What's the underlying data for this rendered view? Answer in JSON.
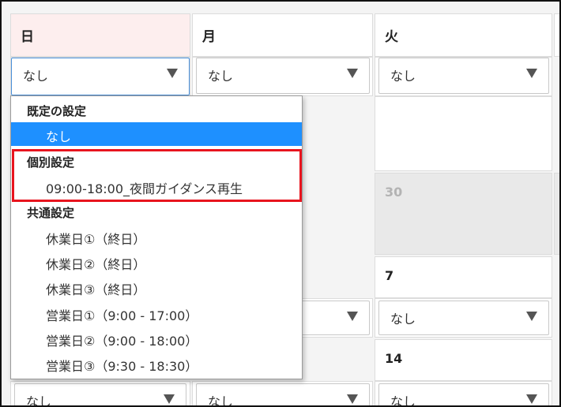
{
  "calendar": {
    "weekdays": {
      "sun": "日",
      "mon": "月",
      "tue": "火"
    },
    "dates": {
      "tue_row2": "30",
      "tue_row3": "7",
      "tue_row4": "14"
    },
    "select_default_value": "なし"
  },
  "dropdown": {
    "groups": {
      "default": {
        "label": "既定の設定",
        "options": [
          "なし"
        ],
        "selected_index": 0
      },
      "individual": {
        "label": "個別設定",
        "options": [
          "09:00-18:00_夜間ガイダンス再生"
        ]
      },
      "common": {
        "label": "共通設定",
        "options": [
          "休業日①（終日）",
          "休業日②（終日）",
          "休業日③（終日）",
          "営業日①（9:00 - 17:00）",
          "営業日②（9:00 - 18:00）",
          "営業日③（9:30 - 18:30）"
        ]
      }
    }
  },
  "colors": {
    "selected_bg": "#1e90ff",
    "highlight_border": "#e8141e",
    "sunday_header_bg": "#fdeeee"
  }
}
